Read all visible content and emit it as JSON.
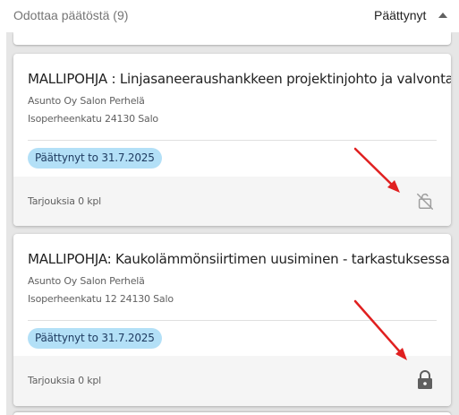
{
  "header": {
    "title": "Odottaa päätöstä (9)",
    "filter_label": "Päättynyt",
    "sort_icon": "caret-up-icon"
  },
  "cards": [
    {
      "title": "MALLIPOHJA : Linjasaneeraushankkeen projektinjohto ja valvonta",
      "company": "Asunto Oy Salon Perhelä",
      "address": "Isoperheenkatu 24130 Salo",
      "status": "Päättynyt to 31.7.2025",
      "offers": "Tarjouksia 0 kpl",
      "lock_icon": "lock-open-disabled-icon"
    },
    {
      "title": "MALLIPOHJA: Kaukolämmönsiirtimen uusiminen - tarkastuksessa",
      "company": "Asunto Oy Salon Perhelä",
      "address": "Isoperheenkatu 12 24130 Salo",
      "status": "Päättynyt to 31.7.2025",
      "offers": "Tarjouksia 0 kpl",
      "lock_icon": "lock-icon"
    }
  ],
  "colors": {
    "status_chip_bg": "#b3e0f7",
    "annotation_arrow": "#e02020",
    "footer_bg": "#f5f5f5"
  }
}
